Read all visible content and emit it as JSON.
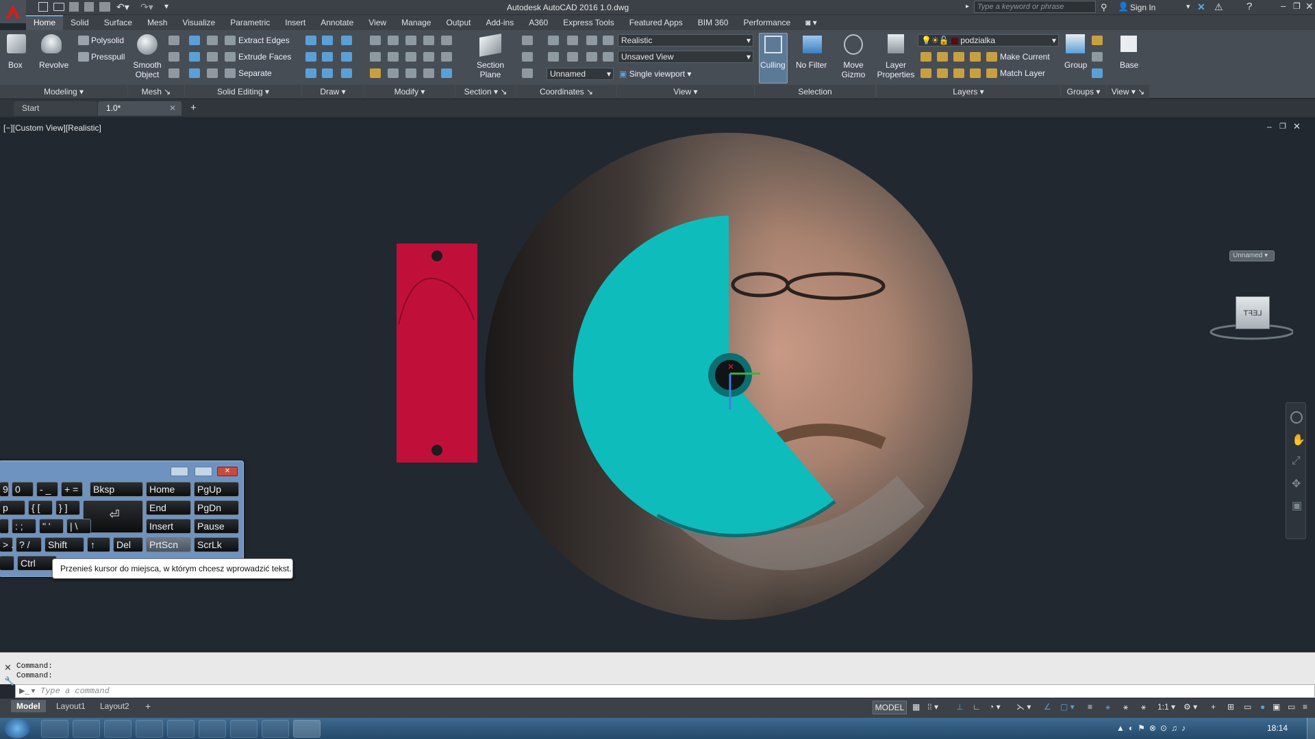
{
  "window": {
    "title": "Autodesk AutoCAD 2016    1.0.dwg",
    "search_placeholder": "Type a keyword or phrase",
    "sign_in": "Sign In"
  },
  "ribbon_tabs": [
    "Home",
    "Solid",
    "Surface",
    "Mesh",
    "Visualize",
    "Parametric",
    "Insert",
    "Annotate",
    "View",
    "Manage",
    "Output",
    "Add-ins",
    "A360",
    "Express Tools",
    "Featured Apps",
    "BIM 360",
    "Performance"
  ],
  "ribbon": {
    "modeling": {
      "box": "Box",
      "revolve": "Revolve",
      "polysolid": "Polysolid",
      "presspull": "Presspull",
      "title": "Modeling"
    },
    "mesh": {
      "smooth_object": "Smooth Object",
      "title": "Mesh"
    },
    "solid_editing": {
      "extract_edges": "Extract Edges",
      "extrude_faces": "Extrude Faces",
      "separate": "Separate",
      "title": "Solid Editing"
    },
    "draw_title": "Draw",
    "modify_title": "Modify",
    "section": {
      "section_plane": "Section Plane",
      "title": "Section"
    },
    "coordinates": {
      "title": "Coordinates",
      "ucs_value": "Unnamed"
    },
    "view": {
      "visual_style": "Realistic",
      "saved_view": "Unsaved View",
      "viewport": "Single viewport",
      "title": "View"
    },
    "selection": {
      "culling": "Culling",
      "no_filter": "No Filter",
      "move_gizmo": "Move Gizmo",
      "title": "Selection"
    },
    "layers": {
      "layer_properties": "Layer Properties",
      "current_layer": "podzialka",
      "make_current": "Make Current",
      "match_layer": "Match Layer",
      "title": "Layers"
    },
    "groups": {
      "group": "Group",
      "title": "Groups"
    },
    "view2": {
      "base": "Base",
      "title": "View"
    }
  },
  "doc_tabs": [
    {
      "label": "Start"
    },
    {
      "label": "1.0*"
    }
  ],
  "viewport": {
    "label": "[−][Custom View][Realistic]",
    "viewcube_face": "LEFT",
    "ucs_name": "Unnamed"
  },
  "osk": {
    "row1": [
      ")",
      "0",
      "-  _",
      "+  =",
      "Bksp",
      "Home",
      "PgUp"
    ],
    "row2": [
      "p",
      "{  [",
      "}  ]",
      "",
      "End",
      "PgDn"
    ],
    "row3": [
      ":  ;",
      "\"  '",
      "|  \\",
      "Insert",
      "Pause"
    ],
    "row4": [
      ">  .",
      "?  /",
      "Shift",
      "↑",
      "Del",
      "PrtScn",
      "ScrLk"
    ],
    "row5": [
      "Ctrl"
    ]
  },
  "tooltip": "Przenieś kursor do miejsca, w którym chcesz wprowadzić tekst.",
  "command": {
    "history": [
      "Command:",
      "Command:"
    ],
    "placeholder": "Type a command"
  },
  "layout_tabs": [
    "Model",
    "Layout1",
    "Layout2"
  ],
  "status": {
    "model": "MODEL",
    "scale": "1:1"
  },
  "taskbar": {
    "time": "18:14"
  },
  "colors": {
    "cyan_solid": "#0fbcbc",
    "red_part": "#c0103a",
    "viewport_bg": "#212830"
  }
}
